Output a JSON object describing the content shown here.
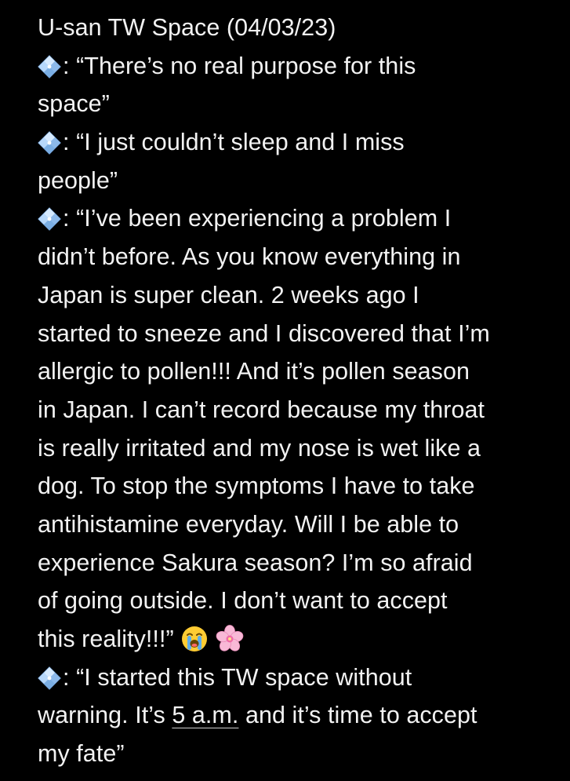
{
  "note": {
    "title": "U-san TW Space (04/03/23)",
    "quotes": [
      {
        "icon": "diamond-shape-with-dot-icon",
        "lines": [
          "“There’s no real purpose for this",
          "space”"
        ]
      },
      {
        "icon": "diamond-shape-with-dot-icon",
        "lines": [
          "“I just couldn’t sleep and I miss",
          "people”"
        ]
      },
      {
        "icon": "diamond-shape-with-dot-icon",
        "lines": [
          "“I’ve been experiencing a problem I",
          "didn’t before. As you know everything in",
          "Japan is super clean. 2 weeks ago I",
          "started to sneeze and I discovered that I’m",
          "allergic to pollen!!! And it’s pollen season",
          "in Japan. I can’t record because my throat",
          "is really irritated and my nose is wet like a",
          "dog. To stop the symptoms I have to take",
          "antihistamine everyday. Will I be able to",
          "experience Sakura season? I’m so afraid",
          "of going outside. I don’t want to accept",
          "this reality!!!”"
        ],
        "trailing_emojis": [
          "loudly-crying-face-icon",
          "cherry-blossom-icon"
        ]
      },
      {
        "icon": "diamond-shape-with-dot-icon",
        "lines": [
          "“I started this TW space without"
        ],
        "line2_before": "warning. It’s ",
        "line2_link": "5 a.m.",
        "line2_after": " and it’s time to accept",
        "line3": "my fate”"
      }
    ],
    "colors": {
      "background": "#000000",
      "text": "#f2f2f2",
      "gem": "#9ec3ee"
    }
  }
}
